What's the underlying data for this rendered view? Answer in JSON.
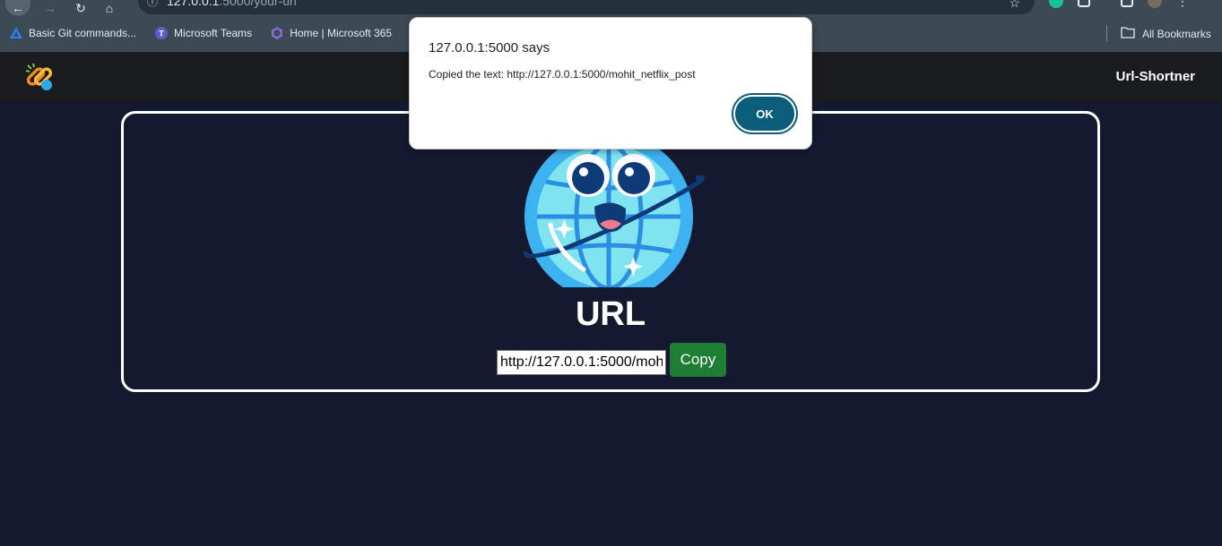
{
  "browser": {
    "url_host": "127.0.0.1",
    "url_path": ":5000/your-url",
    "bookmarks": [
      {
        "label": "Basic Git commands..."
      },
      {
        "label": "Microsoft Teams"
      },
      {
        "label": "Home | Microsoft 365"
      }
    ],
    "all_bookmarks_label": "All Bookmarks"
  },
  "navbar": {
    "brand": "Url-Shortner"
  },
  "card": {
    "title": "URL",
    "input_value": "http://127.0.0.1:5000/mohit_netflix_post",
    "copy_label": "Copy"
  },
  "dialog": {
    "title": "127.0.0.1:5000 says",
    "message": "Copied the text: http://127.0.0.1:5000/mohit_netflix_post",
    "ok_label": "OK"
  },
  "colors": {
    "page_bg": "#141930",
    "navbar_bg": "#1a1b1c",
    "copy_green": "#1e7e34",
    "ok_blue": "#0b5d7a"
  }
}
